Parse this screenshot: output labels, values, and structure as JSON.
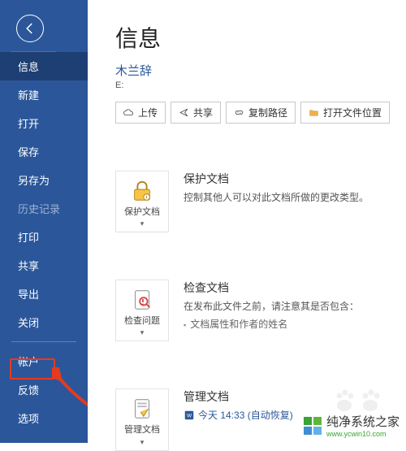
{
  "sidebar": {
    "items": [
      {
        "label": "信息",
        "active": true
      },
      {
        "label": "新建"
      },
      {
        "label": "打开"
      },
      {
        "label": "保存"
      },
      {
        "label": "另存为"
      },
      {
        "label": "历史记录",
        "disabled": true
      },
      {
        "label": "打印"
      },
      {
        "label": "共享"
      },
      {
        "label": "导出"
      },
      {
        "label": "关闭"
      }
    ],
    "footer": [
      {
        "label": "帐户"
      },
      {
        "label": "反馈"
      },
      {
        "label": "选项"
      }
    ]
  },
  "main": {
    "title": "信息",
    "doc_title": "木兰辞",
    "doc_path": "E:",
    "buttons": {
      "upload": "上传",
      "share": "共享",
      "copy_path": "复制路径",
      "open_loc": "打开文件位置"
    },
    "sections": {
      "protect": {
        "tile": "保护文档",
        "title": "保护文档",
        "desc": "控制其他人可以对此文档所做的更改类型。"
      },
      "inspect": {
        "tile": "检查问题",
        "title": "检查文档",
        "desc": "在发布此文件之前，请注意其是否包含：",
        "sub": "文档属性和作者的姓名"
      },
      "manage": {
        "tile": "管理文档",
        "title": "管理文档",
        "recover": "今天 14:33 (自动恢复)"
      }
    }
  },
  "watermark": "纯净系统之家",
  "watermark_url": "www.ycwin10.com"
}
